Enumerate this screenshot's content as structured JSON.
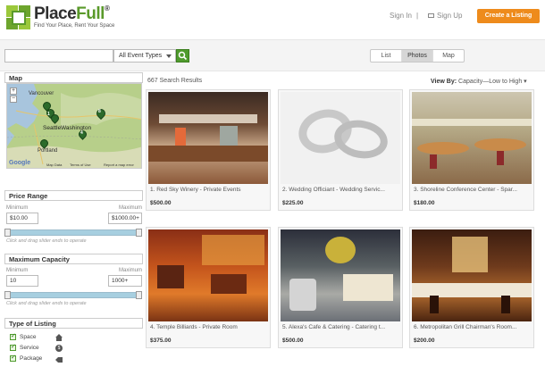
{
  "header": {
    "brand": "PlaceFull",
    "brand_a": "Place",
    "brand_b": "Full",
    "brand_mark": "®",
    "tagline": "Find Your Place, Rent Your Space",
    "signin": "Sign In",
    "signup": "Sign Up",
    "cta": "Create a Listing",
    "accent": "#ee8b1c",
    "brand_green": "#5a9a2a"
  },
  "search": {
    "query_value": "",
    "event_type": "All Event Types",
    "button_icon": "search-icon"
  },
  "view_modes": [
    "List",
    "Photos",
    "Map"
  ],
  "view_active": "Photos",
  "sidebar": {
    "map": {
      "title": "Map",
      "cities": [
        "Vancouver",
        "Seattle",
        "Washington",
        "Portland"
      ],
      "attribution": [
        "Map Data",
        "Terms of Use",
        "Report a map error"
      ],
      "google": "Google",
      "pins": [
        "1",
        "8",
        "4"
      ]
    },
    "price": {
      "title": "Price Range",
      "min_label": "Minimum",
      "max_label": "Maximum",
      "min_value": "$10.00",
      "max_value": "$1000.00+",
      "hint": "Click and drag slider ends to operate"
    },
    "capacity": {
      "title": "Maximum Capacity",
      "min_label": "Minimum",
      "max_label": "Maximum",
      "min_value": "10",
      "max_value": "1000+",
      "hint": "Click and drag slider ends to operate"
    },
    "listing_type": {
      "title": "Type of Listing",
      "items": [
        {
          "label": "Space",
          "icon": "home-icon"
        },
        {
          "label": "Service",
          "icon": "service-icon"
        },
        {
          "label": "Package",
          "icon": "tag-icon"
        }
      ]
    }
  },
  "results": {
    "count": "667",
    "count_label": "Search Results",
    "view_by_label": "View By:",
    "view_by_value": "Capacity—Low to High",
    "listings": [
      {
        "title": "1. Red Sky Winery - Private Events",
        "price": "$500.00"
      },
      {
        "title": "2. Wedding Officiant - Wedding Servic...",
        "price": "$225.00"
      },
      {
        "title": "3. Shoreline Conference Center - Spar...",
        "price": "$180.00"
      },
      {
        "title": "4. Temple Billiards - Private Room",
        "price": "$375.00"
      },
      {
        "title": "5. Alexa's Cafe & Catering - Catering t...",
        "price": "$500.00"
      },
      {
        "title": "6. Metropolitan Grill Chairman's Room...",
        "price": "$200.00"
      }
    ]
  }
}
